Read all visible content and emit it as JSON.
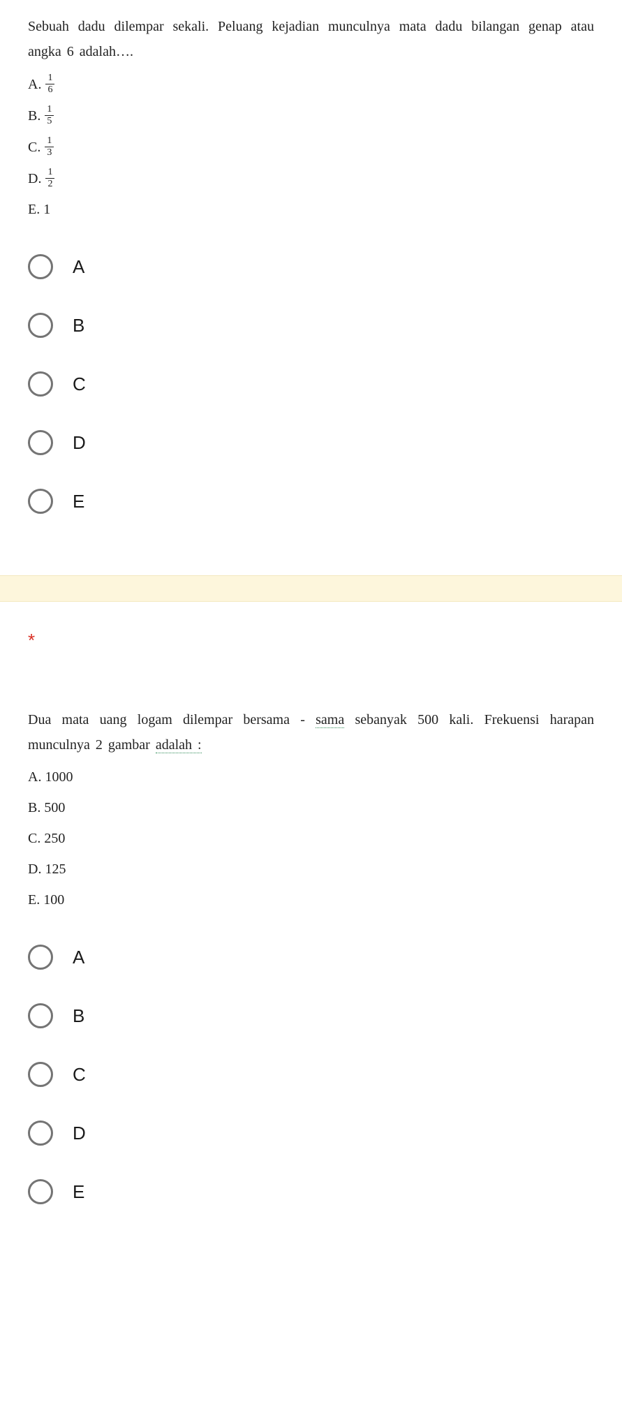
{
  "q1": {
    "text": "Sebuah dadu dilempar sekali. Peluang kejadian munculnya mata dadu bilangan genap atau angka 6 adalah….",
    "options": {
      "A": {
        "prefix": "A.",
        "num": "1",
        "den": "6"
      },
      "B": {
        "prefix": "B.",
        "num": "1",
        "den": "5"
      },
      "C": {
        "prefix": "C.",
        "num": "1",
        "den": "3"
      },
      "D": {
        "prefix": "D.",
        "num": "1",
        "den": "2"
      },
      "E": {
        "prefix": "E. 1"
      }
    },
    "radios": [
      "A",
      "B",
      "C",
      "D",
      "E"
    ]
  },
  "q2": {
    "required": "*",
    "text_p1": "Dua mata uang logam dilempar bersama - ",
    "text_u1": "sama",
    "text_p2": " sebanyak 500 kali. Frekuensi harapan munculnya 2 gambar ",
    "text_u2": "adalah :",
    "options": {
      "A": "A. 1000",
      "B": "B. 500",
      "C": "C. 250",
      "D": "D. 125",
      "E": "E. 100"
    },
    "radios": [
      "A",
      "B",
      "C",
      "D",
      "E"
    ]
  }
}
